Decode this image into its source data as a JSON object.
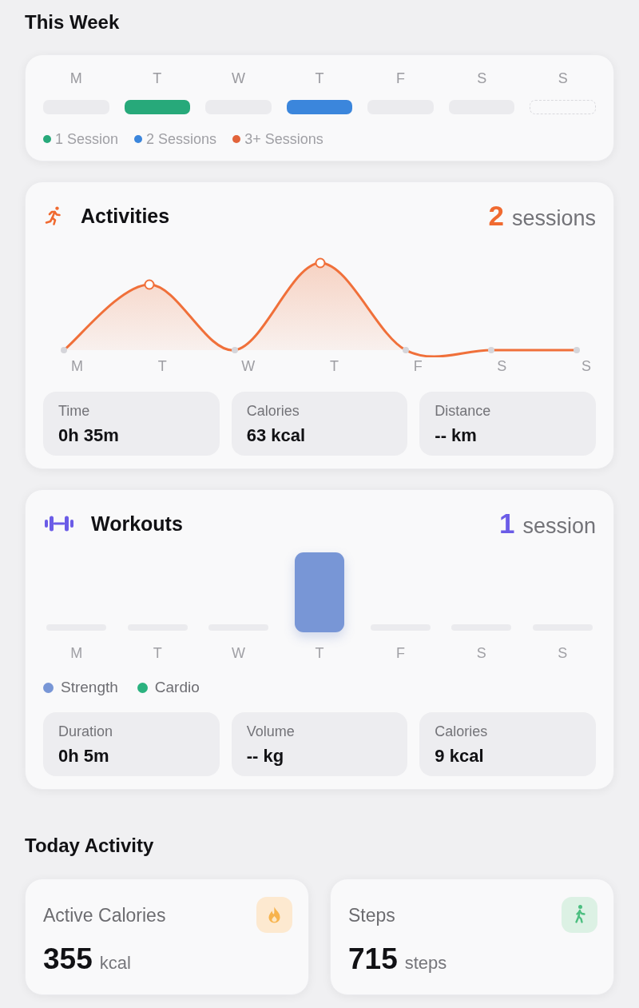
{
  "this_week": {
    "title": "This Week",
    "days": [
      {
        "label": "M",
        "kind": "none"
      },
      {
        "label": "T",
        "kind": "one"
      },
      {
        "label": "W",
        "kind": "none"
      },
      {
        "label": "T",
        "kind": "two"
      },
      {
        "label": "F",
        "kind": "none"
      },
      {
        "label": "S",
        "kind": "none"
      },
      {
        "label": "S",
        "kind": "pending"
      }
    ],
    "legend": [
      {
        "label": "1 Session",
        "color": "#27a97a"
      },
      {
        "label": "2 Sessions",
        "color": "#3b86dc"
      },
      {
        "label": "3+ Sessions",
        "color": "#e2633a"
      }
    ]
  },
  "activities": {
    "title": "Activities",
    "count": "2",
    "count_unit": "sessions",
    "chart_days": [
      {
        "label": "M",
        "marked": false
      },
      {
        "label": "T",
        "marked": true
      },
      {
        "label": "W",
        "marked": false
      },
      {
        "label": "T",
        "marked": true
      },
      {
        "label": "F",
        "marked": false
      },
      {
        "label": "S",
        "marked": false
      },
      {
        "label": "S",
        "marked": false
      }
    ],
    "stats": [
      {
        "label": "Time",
        "value": "0h 35m"
      },
      {
        "label": "Calories",
        "value": "63 kcal"
      },
      {
        "label": "Distance",
        "value": "-- km"
      }
    ]
  },
  "workouts": {
    "title": "Workouts",
    "count": "1",
    "count_unit": "session",
    "days": [
      {
        "label": "M",
        "kind": "none"
      },
      {
        "label": "T",
        "kind": "none"
      },
      {
        "label": "W",
        "kind": "none"
      },
      {
        "label": "T",
        "kind": "strength"
      },
      {
        "label": "F",
        "kind": "none"
      },
      {
        "label": "S",
        "kind": "none"
      },
      {
        "label": "S",
        "kind": "none"
      }
    ],
    "legend": [
      {
        "label": "Strength",
        "color": "#7896d6"
      },
      {
        "label": "Cardio",
        "color": "#2bb27f"
      }
    ],
    "stats": [
      {
        "label": "Duration",
        "value": "0h 5m"
      },
      {
        "label": "Volume",
        "value": "-- kg"
      },
      {
        "label": "Calories",
        "value": "9 kcal"
      }
    ]
  },
  "today": {
    "title": "Today Activity",
    "cards": [
      {
        "kind": "calories",
        "label": "Active Calories",
        "value": "355",
        "unit": "kcal"
      },
      {
        "kind": "steps",
        "label": "Steps",
        "value": "715",
        "unit": "steps"
      }
    ]
  }
}
